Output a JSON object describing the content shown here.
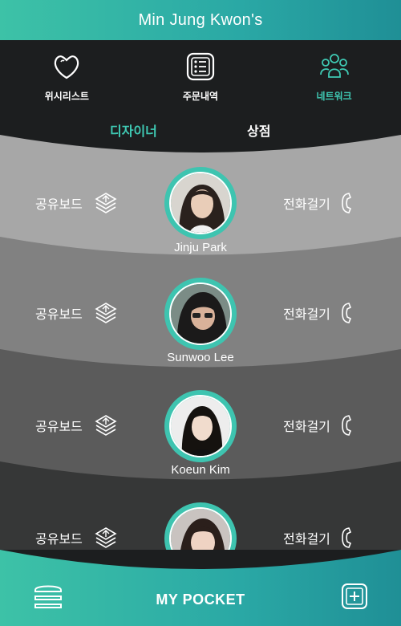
{
  "header": {
    "title": "Min Jung Kwon's"
  },
  "nav": [
    {
      "label": "위시리스트",
      "icon": "heart-icon",
      "active": false
    },
    {
      "label": "주문내역",
      "icon": "order-list-icon",
      "active": false
    },
    {
      "label": "네트워크",
      "icon": "network-people-icon",
      "active": true
    }
  ],
  "subtabs": {
    "designer": "디자이너",
    "shop": "상점"
  },
  "actions": {
    "share": "공유보드",
    "call": "전화걸기"
  },
  "designers": [
    {
      "name": "Jinju Park"
    },
    {
      "name": "Sunwoo Lee"
    },
    {
      "name": "Koeun Kim"
    },
    {
      "name": ""
    }
  ],
  "footer": {
    "brand": "MY POCKET"
  },
  "colors": {
    "accent": "#3fcab4",
    "header_start": "#3dc2a7",
    "header_end": "#1f8f96",
    "dark": "#1c1e1f"
  }
}
